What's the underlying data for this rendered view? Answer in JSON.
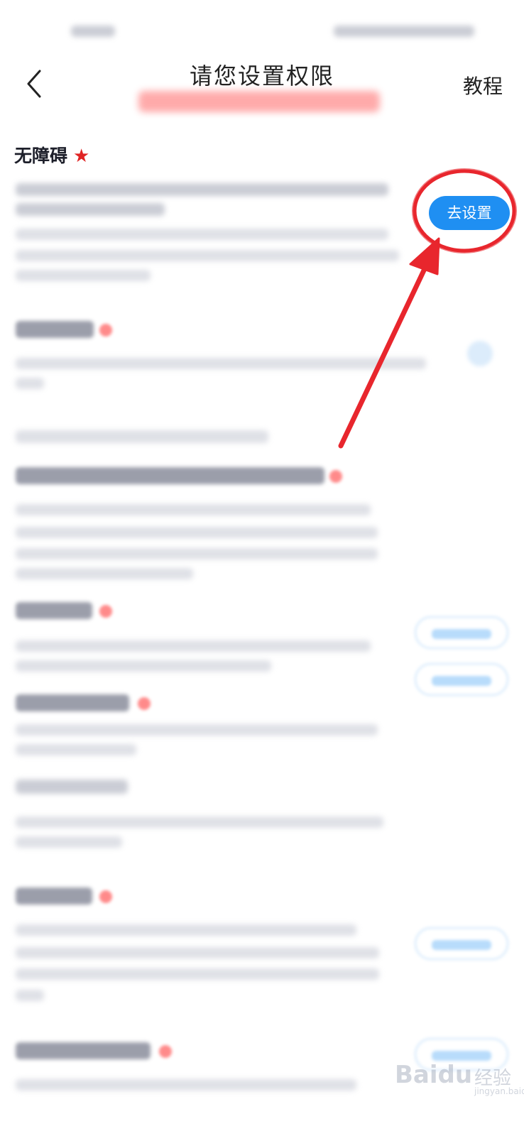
{
  "nav": {
    "back_icon": "chevron-left-icon",
    "title": "请您设置权限",
    "tutorial_label": "教程"
  },
  "accessibility": {
    "title": "无障碍",
    "required_mark": "★",
    "button_label": "去设置"
  },
  "watermark": {
    "brand": "Baidu",
    "brand_cn": "经验",
    "url": "jingyan.baidu.com"
  },
  "colors": {
    "accent": "#1f8ff2",
    "annotation": "#e8262d",
    "required": "#e02424"
  }
}
